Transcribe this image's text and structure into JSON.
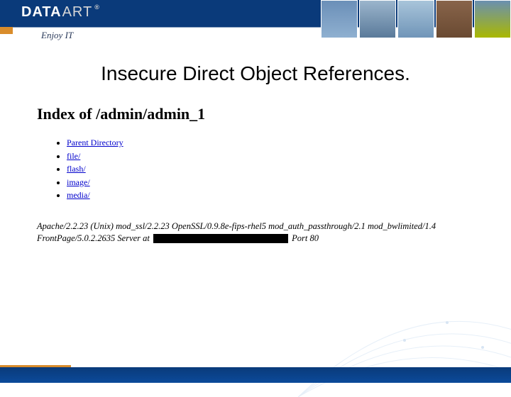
{
  "brand": {
    "logo_primary": "DATA",
    "logo_secondary": "ART",
    "registered": "®",
    "tagline": "Enjoy IT"
  },
  "slide": {
    "title": "Insecure Direct Object References."
  },
  "directory": {
    "heading": "Index of /admin/admin_1",
    "items": [
      "Parent Directory",
      "file/",
      "flash/",
      "image/",
      "media/"
    ]
  },
  "server": {
    "line1": "Apache/2.2.23 (Unix) mod_ssl/2.2.23 OpenSSL/0.9.8e-fips-rhel5 mod_auth_passthrough/2.1 mod_bwlimited/1.4 FrontPage/5.0.2.2635 Server at ",
    "line2": " Port 80"
  }
}
